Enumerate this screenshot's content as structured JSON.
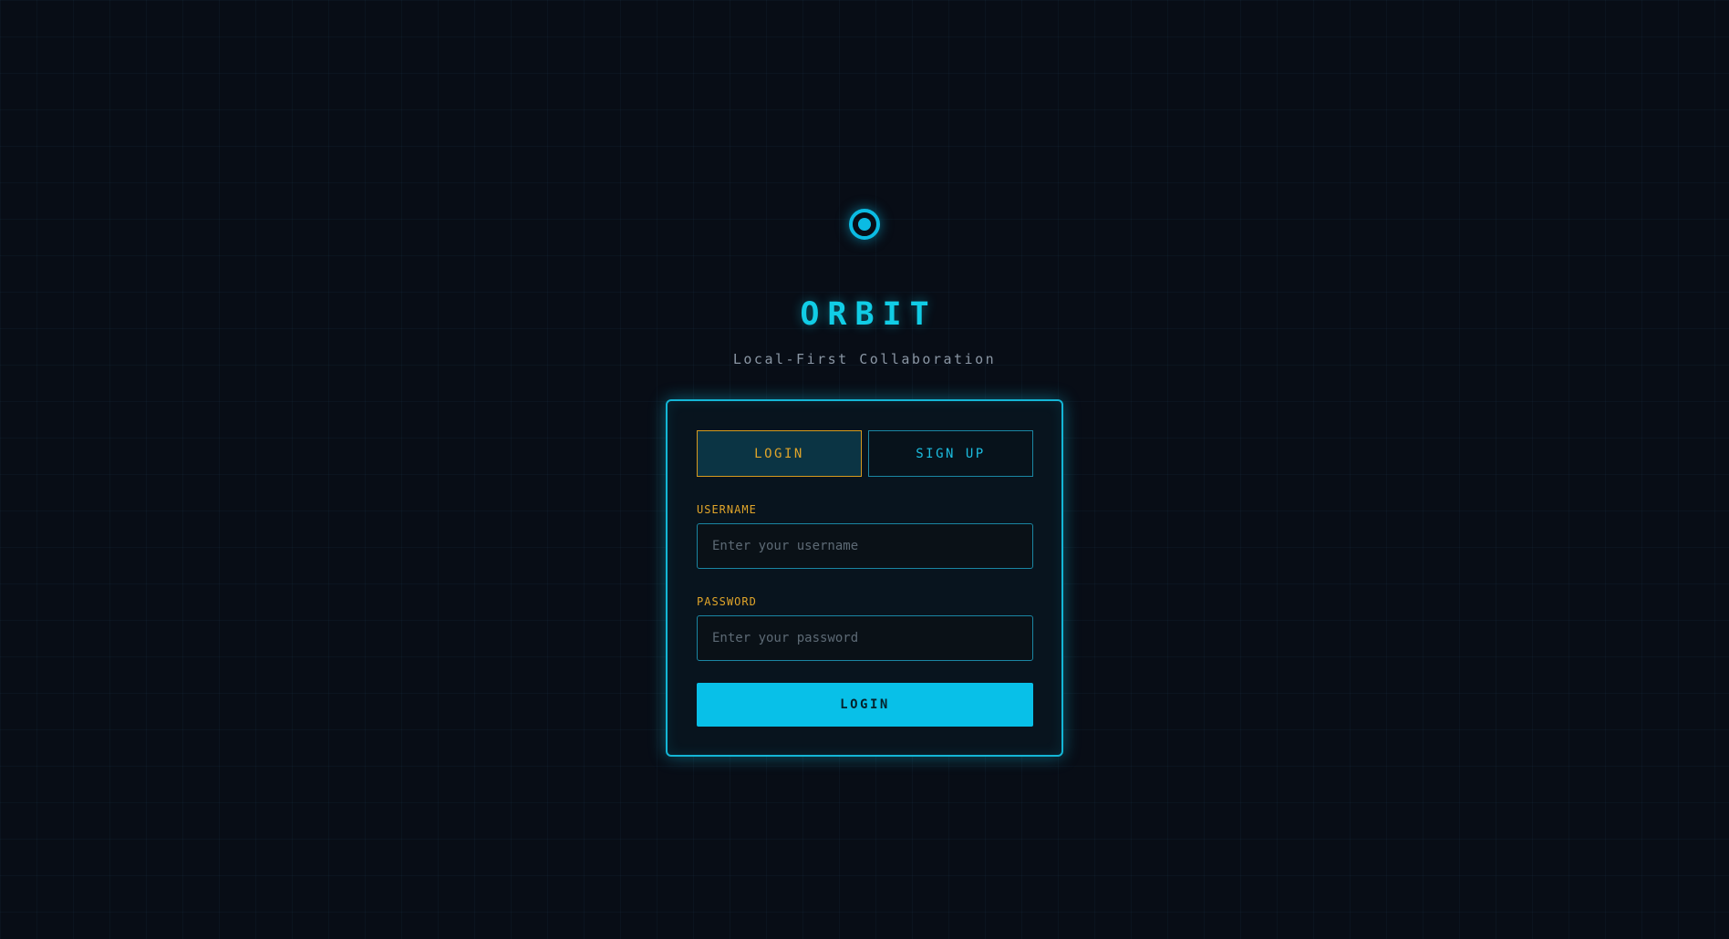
{
  "brand": {
    "logo_icon": "orbit-ring-icon",
    "title": "ORBIT",
    "subtitle": "Local-First Collaboration"
  },
  "auth": {
    "tabs": [
      {
        "label": "LOGIN",
        "active": true
      },
      {
        "label": "SIGN UP",
        "active": false
      }
    ],
    "username": {
      "label": "USERNAME",
      "value": "",
      "placeholder": "Enter your username"
    },
    "password": {
      "label": "PASSWORD",
      "value": "",
      "placeholder": "Enter your password"
    },
    "submit_label": "LOGIN"
  },
  "colors": {
    "background": "#080d16",
    "accent_cyan": "#0bbbe3",
    "accent_amber": "#e0a52a",
    "card_bg": "#08141e"
  }
}
